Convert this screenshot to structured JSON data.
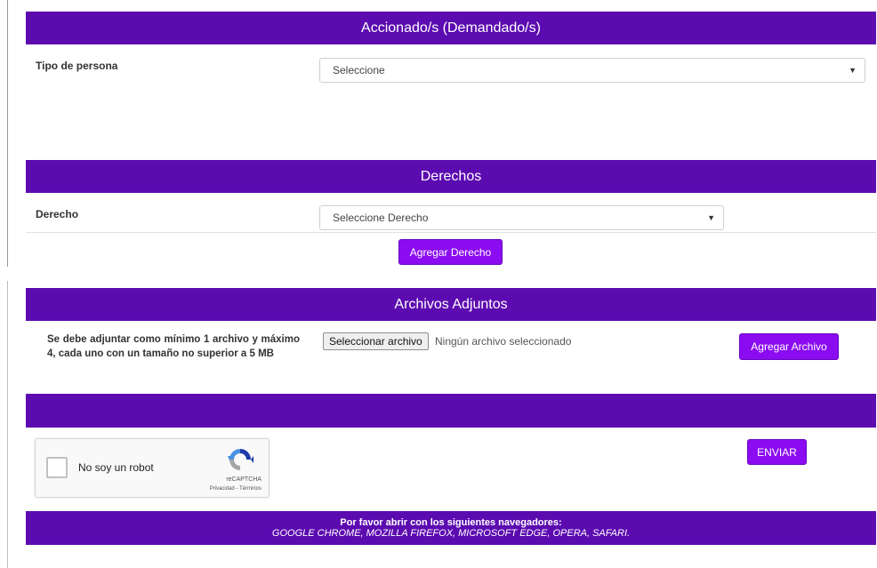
{
  "sections": {
    "accionados": {
      "title": "Accionado/s (Demandado/s)"
    },
    "derechos": {
      "title": "Derechos"
    },
    "archivos": {
      "title": "Archivos Adjuntos"
    }
  },
  "tipo_persona": {
    "label": "Tipo de persona",
    "selected": "Seleccione"
  },
  "derecho": {
    "label": "Derecho",
    "selected": "Seleccione Derecho",
    "add_button": "Agregar Derecho"
  },
  "adjuntos": {
    "note": "Se debe adjuntar como mínimo 1 archivo y máximo 4, cada uno con un tamaño no superior a 5 MB",
    "file_button": "Seleccionar archivo",
    "file_status": "Ningún archivo seleccionado",
    "add_button": "Agregar Archivo"
  },
  "captcha": {
    "label": "No soy un robot",
    "brand": "reCAPTCHA",
    "terms": "Privacidad - Términos"
  },
  "submit": {
    "label": "ENVIAR"
  },
  "footer": {
    "line1": "Por favor abrir con los siguientes navegadores:",
    "line2": "GOOGLE CHROME, MOZILLA FIREFOX, MICROSOFT EDGE, OPERA, SAFARI."
  },
  "icons": {
    "select_arrow": "caret-down-icon",
    "captcha_logo": "recaptcha-logo-icon"
  },
  "colors": {
    "header": "#5c0bb0",
    "button": "#8b0cf0"
  }
}
